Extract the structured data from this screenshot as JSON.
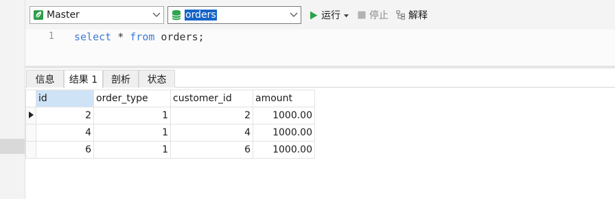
{
  "toolbar": {
    "connection": {
      "value": "Master",
      "icon": "connection-leaf-icon"
    },
    "database": {
      "value": "orders",
      "icon": "database-icon"
    },
    "run_label": "运行",
    "stop_label": "停止",
    "explain_label": "解释"
  },
  "editor": {
    "line_number": "1",
    "code": {
      "kw1": "select",
      "p1": " * ",
      "kw2": "from",
      "p2": " orders;"
    }
  },
  "tabs": [
    {
      "label": "信息"
    },
    {
      "label": "结果 1"
    },
    {
      "label": "剖析"
    },
    {
      "label": "状态"
    }
  ],
  "results": {
    "columns": [
      "id",
      "order_type",
      "customer_id",
      "amount"
    ],
    "rows": [
      [
        "2",
        "1",
        "2",
        "1000.00"
      ],
      [
        "4",
        "1",
        "4",
        "1000.00"
      ],
      [
        "6",
        "1",
        "6",
        "1000.00"
      ]
    ]
  },
  "colors": {
    "accent": "#1464c8",
    "run_green": "#2aa34a",
    "keyword_blue": "#3d7bd6",
    "selected_column": "#cfe3f7"
  }
}
